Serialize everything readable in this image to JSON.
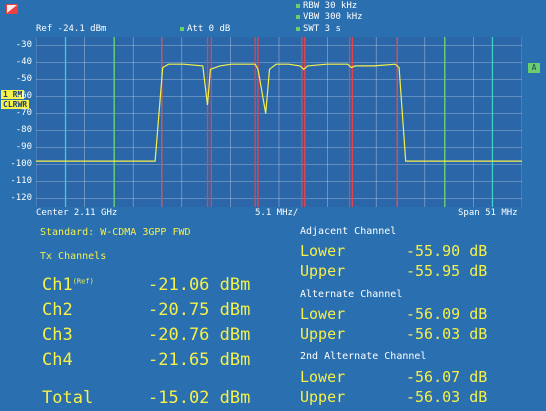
{
  "header": {
    "ref": "Ref  -24.1 dBm",
    "att": "Att   0 dB",
    "rbw": "RBW 30 kHz",
    "vbw": "VBW 300 kHz",
    "swt": "SWT 3 s"
  },
  "side": {
    "trace_line1": "1 RM",
    "trace_line2": "CLRWR",
    "trace_tag": "A"
  },
  "footer": {
    "center": "Center 2.11 GHz",
    "span_per_div": "5.1 MHz/",
    "span": "Span 51 MHz"
  },
  "results": {
    "standard": "Standard: W-CDMA 3GPP FWD",
    "tx_title": "Tx Channels",
    "channels": [
      {
        "name": "Ch1",
        "sup": "(Ref)",
        "value": "-21.06 dBm"
      },
      {
        "name": "Ch2",
        "sup": "",
        "value": "-20.75 dBm"
      },
      {
        "name": "Ch3",
        "sup": "",
        "value": "-20.76 dBm"
      },
      {
        "name": "Ch4",
        "sup": "",
        "value": "-21.65 dBm"
      }
    ],
    "total_label": "Total",
    "total_value": "-15.02 dBm",
    "adjacent_title": "Adjacent Channel",
    "adjacent_lower_label": "Lower",
    "adjacent_lower": "-55.90 dB",
    "adjacent_upper_label": "Upper",
    "adjacent_upper": "-55.95 dB",
    "alternate_title": "Alternate Channel",
    "alternate_lower_label": "Lower",
    "alternate_lower": "-56.09 dB",
    "alternate_upper_label": "Upper",
    "alternate_upper": "-56.03 dB",
    "alt2_title": "2nd Alternate Channel",
    "alt2_lower_label": "Lower",
    "alt2_lower": "-56.07 dB",
    "alt2_upper_label": "Upper",
    "alt2_upper": "-56.03 dB"
  },
  "chart_data": {
    "type": "line",
    "y_ticks": [
      "-30",
      "-40",
      "-50",
      "-60",
      "-70",
      "-80",
      "-90",
      "-100",
      "-110",
      "-120"
    ],
    "ylim": [
      -125,
      -25
    ],
    "x_center_ghz": 2.11,
    "span_mhz": 51,
    "series": [
      {
        "x": [
          -25.5,
          -13.0,
          -12.2,
          -11.6,
          -10.0,
          -8.0,
          -7.5,
          -7.2,
          -6.2,
          -5.0,
          -2.5,
          -2.2,
          -1.4,
          -1.0,
          -0.3,
          1.0,
          2.2,
          2.6,
          3.0,
          5.0,
          7.2,
          7.6,
          8.0,
          10.0,
          12.2,
          12.6,
          13.3,
          25.5
        ],
        "y": [
          -98,
          -98,
          -43,
          -41,
          -41,
          -42,
          -65,
          -44,
          -42,
          -41,
          -41,
          -44,
          -70,
          -44,
          -41,
          -41,
          -42,
          -44,
          -42,
          -41,
          -41,
          -43,
          -42,
          -42,
          -41,
          -43,
          -98,
          -98
        ],
        "color": "#f5f04a"
      }
    ],
    "markers": {
      "tx_edges_mhz": [
        -12.3,
        -7.5,
        -7.1,
        -2.5,
        -2.2,
        2.4,
        2.7,
        7.4,
        7.7,
        12.4
      ],
      "adjacent_mhz": [
        -17.3,
        -12.3,
        12.4,
        17.4
      ],
      "alternate_mhz": [
        -22.4,
        -17.3,
        17.4,
        22.4
      ]
    },
    "colors": {
      "tx_edge": "#e0454d",
      "adjacent": "#6ad16a",
      "alternate": "#3fd0c7",
      "grid": "#c8d3e8",
      "plot_bg": "#2a66a8"
    }
  }
}
